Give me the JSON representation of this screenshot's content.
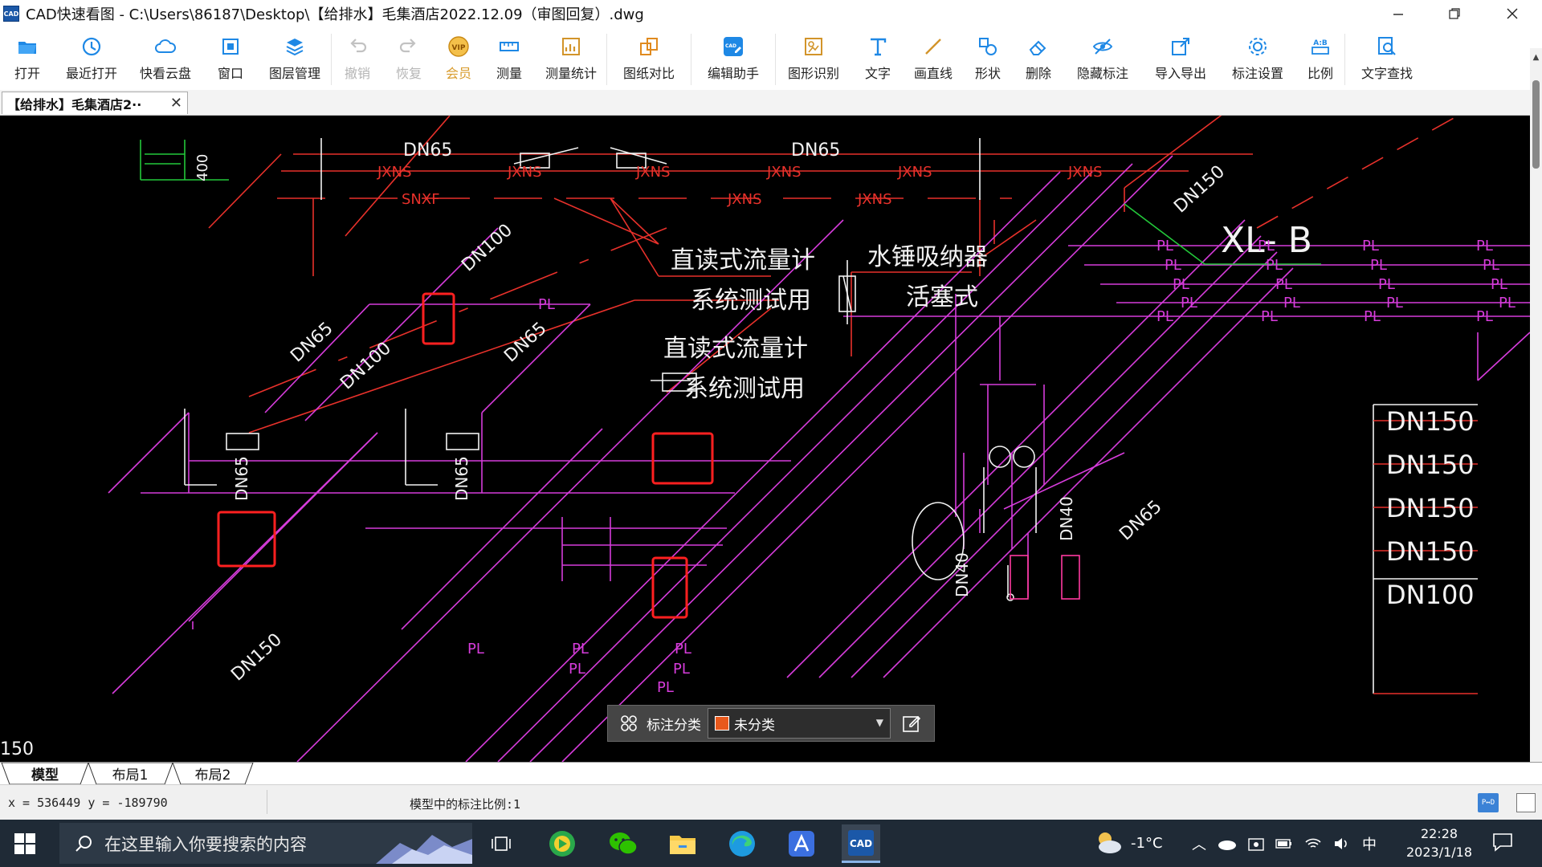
{
  "window": {
    "title": "CAD快速看图 - C:\\Users\\86187\\Desktop\\【给排水】毛集酒店2022.12.09（审图回复）.dwg",
    "app_icon_text": "CAD"
  },
  "toolbar": {
    "items": [
      {
        "label": "打开",
        "icon": "folder-open-icon"
      },
      {
        "label": "最近打开",
        "icon": "recent-clock-icon"
      },
      {
        "label": "快看云盘",
        "icon": "cloud-icon"
      },
      {
        "label": "窗口",
        "icon": "window-icon"
      },
      {
        "label": "图层管理",
        "icon": "layers-icon"
      },
      {
        "label": "撤销",
        "icon": "undo-icon"
      },
      {
        "label": "恢复",
        "icon": "redo-icon"
      },
      {
        "label": "会员",
        "icon": "vip-icon"
      },
      {
        "label": "测量",
        "icon": "ruler-icon"
      },
      {
        "label": "测量统计",
        "icon": "measure-stats-icon"
      },
      {
        "label": "图纸对比",
        "icon": "compare-icon"
      },
      {
        "label": "编辑助手",
        "icon": "edit-assistant-icon"
      },
      {
        "label": "图形识别",
        "icon": "shape-recognition-icon"
      },
      {
        "label": "文字",
        "icon": "text-icon"
      },
      {
        "label": "画直线",
        "icon": "line-icon"
      },
      {
        "label": "形状",
        "icon": "shapes-icon"
      },
      {
        "label": "删除",
        "icon": "eraser-icon"
      },
      {
        "label": "隐藏标注",
        "icon": "hide-eye-icon"
      },
      {
        "label": "导入导出",
        "icon": "import-export-icon"
      },
      {
        "label": "标注设置",
        "icon": "annotation-settings-icon"
      },
      {
        "label": "比例",
        "icon": "scale-icon"
      },
      {
        "label": "文字查找",
        "icon": "text-search-icon"
      }
    ]
  },
  "document_tab": {
    "label": "【给排水】毛集酒店2··"
  },
  "drawing": {
    "labels": {
      "dn65_a": "DN65",
      "dn65_b": "DN65",
      "dn100_a": "DN100",
      "dn65_c": "DN65",
      "dn100_b": "DN100",
      "dn65_d": "DN65",
      "dn65_e": "DN65",
      "dn65_f": "DN65",
      "dn150_a": "DN150",
      "dn150_b": "DN150",
      "dn40_a": "DN40",
      "dn40_b": "DN40",
      "dn65_g": "DN65",
      "xl_b": "XL- B",
      "flowmeter_1a": "直读式流量计",
      "flowmeter_1b": "系统测试用",
      "flowmeter_2a": "直读式流量计",
      "flowmeter_2b": "系统测试用",
      "hammer_a": "水锤吸纳器",
      "hammer_b": "活塞式",
      "snxf": "SNXF",
      "pl": "PL",
      "jxns": "JXNS",
      "dim_400": "400",
      "edge_150": "150",
      "right_table": [
        "DN150",
        "DN150",
        "DN150",
        "DN150",
        "DN100"
      ]
    }
  },
  "annotation_bar": {
    "label": "标注分类",
    "selected": "未分类",
    "swatch_color": "#e8591c"
  },
  "layout_tabs": {
    "model": "模型",
    "layout1": "布局1",
    "layout2": "布局2"
  },
  "status": {
    "coords": "x = 536449 y = -189790",
    "scale": "模型中的标注比例:1"
  },
  "taskbar": {
    "search_placeholder": "在这里输入你要搜索的内容",
    "weather": "-1°C",
    "ime": "中",
    "time": "22:28",
    "date": "2023/1/18"
  },
  "colors": {
    "magenta": "#d63cdb",
    "red": "#e8312b",
    "white": "#f2f2f2",
    "green": "#23c93a",
    "highlight": "#ff2020"
  }
}
